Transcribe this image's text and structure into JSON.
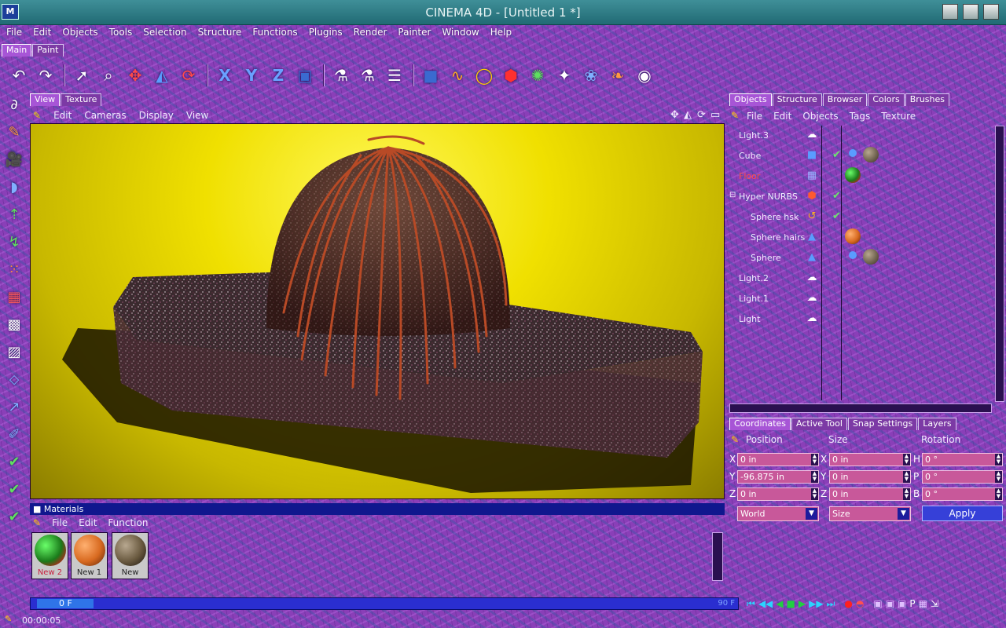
{
  "window": {
    "title": "CINEMA 4D - [Untitled 1 *]"
  },
  "menubar": [
    "File",
    "Edit",
    "Objects",
    "Tools",
    "Selection",
    "Structure",
    "Functions",
    "Plugins",
    "Render",
    "Painter",
    "Window",
    "Help"
  ],
  "main_tabs": [
    "Main",
    "Paint"
  ],
  "toolbar_icons": [
    "undo-icon",
    "redo-icon",
    "select-arrow-icon",
    "live-selection-icon",
    "move-icon",
    "scale-icon",
    "rotate-icon",
    "x-axis-icon",
    "y-axis-icon",
    "z-axis-icon",
    "coordinate-system-icon",
    "render-view-icon",
    "render-region-icon",
    "render-settings-icon",
    "cube-primitive-icon",
    "spline-icon",
    "circle-spline-icon",
    "nurbs-icon",
    "array-icon",
    "camera-icon",
    "light-icon",
    "deformer-icon",
    "scene-icon",
    "sound-icon"
  ],
  "viewport": {
    "tabs": [
      "View",
      "Texture"
    ],
    "menu": [
      "Edit",
      "Cameras",
      "Display",
      "View"
    ]
  },
  "materials": {
    "title": "Materials",
    "menu": [
      "File",
      "Edit",
      "Function"
    ],
    "items": [
      {
        "name": "New 2",
        "color": "#2a8a2a"
      },
      {
        "name": "New 1",
        "color": "#d86a20"
      },
      {
        "name": "New",
        "color": "#6a5a40"
      }
    ]
  },
  "timeline": {
    "current_frame": "0 F",
    "end_frame": "90 F"
  },
  "status": {
    "time": "00:00:05"
  },
  "right_tabs": [
    "Objects",
    "Structure",
    "Browser",
    "Colors",
    "Brushes"
  ],
  "object_menu": [
    "File",
    "Edit",
    "Objects",
    "Tags",
    "Texture"
  ],
  "objects": [
    {
      "name": "Light.3",
      "icon": "light-icon",
      "check": false
    },
    {
      "name": "Cube",
      "icon": "cube-icon",
      "check": true
    },
    {
      "name": "Floor",
      "icon": "floor-icon",
      "check": false
    },
    {
      "name": "Hyper NURBS",
      "icon": "hypernurbs-icon",
      "check": true
    },
    {
      "name": "Sphere hsk",
      "icon": "sweep-icon",
      "check": true
    },
    {
      "name": "Sphere hairs",
      "icon": "polygon-icon",
      "check": false
    },
    {
      "name": "Sphere",
      "icon": "polygon-icon",
      "check": false
    },
    {
      "name": "Light.2",
      "icon": "light-icon",
      "check": false
    },
    {
      "name": "Light.1",
      "icon": "light-icon",
      "check": false
    },
    {
      "name": "Light",
      "icon": "light-icon",
      "check": false
    }
  ],
  "coord_tabs": [
    "Coordinates",
    "Active Tool",
    "Snap Settings",
    "Layers"
  ],
  "coords": {
    "headers": {
      "position": "Position",
      "size": "Size",
      "rotation": "Rotation"
    },
    "pos_labels": [
      "X",
      "Y",
      "Z"
    ],
    "rot_labels": [
      "H",
      "P",
      "B"
    ],
    "position": [
      "0 in",
      "-96.875 in",
      "0 in"
    ],
    "size": [
      "0 in",
      "0 in",
      "0 in"
    ],
    "rotation": [
      "0 °",
      "0 °",
      "0 °"
    ],
    "mode": "World",
    "size_mode": "Size",
    "apply": "Apply"
  }
}
